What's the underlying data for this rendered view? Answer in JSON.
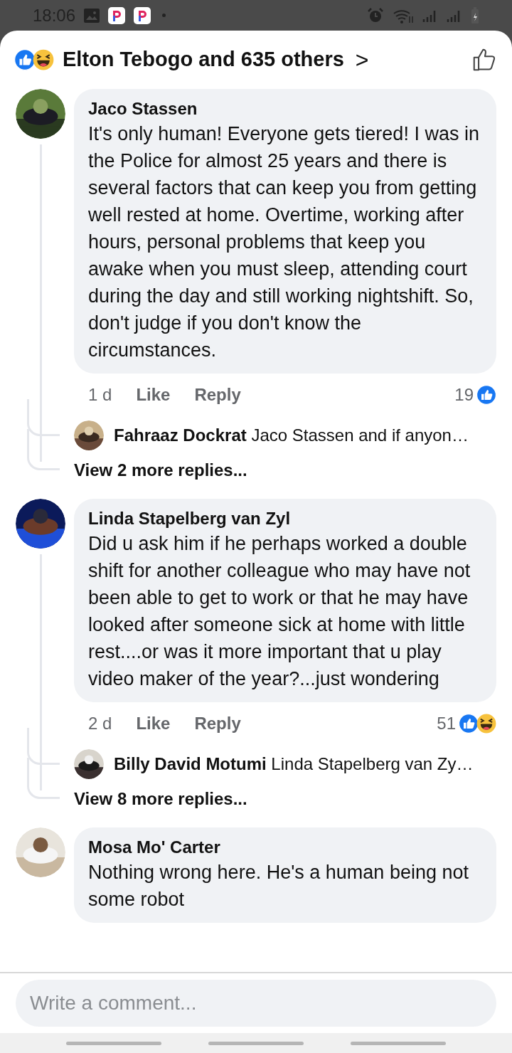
{
  "status_bar": {
    "time": "18:06"
  },
  "header": {
    "reactions": [
      {
        "kind": "like"
      },
      {
        "kind": "haha"
      }
    ],
    "title": "Elton Tebogo and 635 others",
    "chevron": ">"
  },
  "comments": [
    {
      "author": "Jaco Stassen",
      "text": "It's only human! Everyone gets tiered! I was in the Police for almost 25 years and there is several factors that can keep you from getting well rested at home. Overtime, working after hours, personal problems that keep you awake when you must sleep, attending court during the day and still working nightshift. So, don't judge if you don't know the circumstances.",
      "time": "1 d",
      "actions": [
        "Like",
        "Reply"
      ],
      "count": "19",
      "reactions": [
        {
          "kind": "like"
        }
      ],
      "reply": {
        "author": "Fahraaz Dockrat",
        "text": "Jaco Stassen and if anyon…"
      },
      "view_more": "View 2 more replies..."
    },
    {
      "author": "Linda Stapelberg van Zyl",
      "text": "Did u ask him if he perhaps worked a double shift for another colleague who may have not been able to get to work or that he may have looked after someone sick at home with little rest....or was it more important that u play video maker of the year?...just wondering",
      "time": "2 d",
      "actions": [
        "Like",
        "Reply"
      ],
      "count": "51",
      "reactions": [
        {
          "kind": "like"
        },
        {
          "kind": "haha"
        }
      ],
      "reply": {
        "author": "Billy David Motumi",
        "text": "Linda Stapelberg van Zy…"
      },
      "view_more": "View 8 more replies..."
    },
    {
      "author": "Mosa Mo' Carter",
      "text": "Nothing wrong here. He's a human being not some robot"
    }
  ],
  "composer": {
    "placeholder": "Write a comment..."
  }
}
